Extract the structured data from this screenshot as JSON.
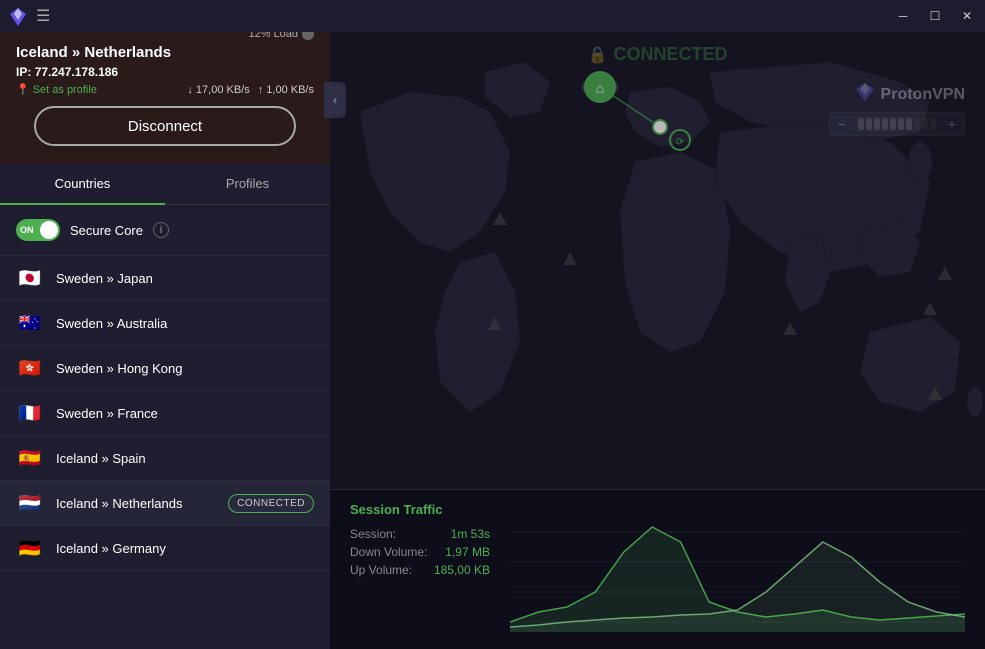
{
  "titlebar": {
    "minimize_label": "─",
    "maximize_label": "☐",
    "close_label": "✕",
    "menu_label": "☰"
  },
  "connection": {
    "title": "Iceland » Netherlands",
    "ip_label": "IP:",
    "ip_value": "77.247.178.186",
    "load_label": "12% Load",
    "set_profile_label": "Set as profile",
    "down_speed": "↓ 17,00 KB/s",
    "up_speed": "↑ 1,00 KB/s",
    "disconnect_label": "Disconnect"
  },
  "tabs": {
    "countries_label": "Countries",
    "profiles_label": "Profiles"
  },
  "secure_core": {
    "toggle_label": "ON",
    "label": "Secure Core",
    "info": "i"
  },
  "map": {
    "connected_label": "CONNECTED",
    "brand_label": "ProtonVPN"
  },
  "countries": [
    {
      "flag": "🇯🇵",
      "name": "Sweden » Japan"
    },
    {
      "flag": "🇦🇺",
      "name": "Sweden » Australia"
    },
    {
      "flag": "🇭🇰",
      "name": "Sweden » Hong Kong"
    },
    {
      "flag": "🇫🇷",
      "name": "Sweden » France"
    },
    {
      "flag": "🇪🇸",
      "name": "Iceland » Spain"
    },
    {
      "flag": "🇳🇱",
      "name": "Iceland » Netherlands",
      "connected": true,
      "badge": "CONNECTED"
    },
    {
      "flag": "🇩🇪",
      "name": "Iceland » Germany"
    }
  ],
  "stats": {
    "title": "Session Traffic",
    "session_label": "Session:",
    "session_value": "1m 53s",
    "down_label": "Down Volume:",
    "down_value": "1,97   MB",
    "up_label": "Up Volume:",
    "up_value": "185,00  KB"
  },
  "colors": {
    "green": "#4caf50",
    "bg_dark": "#141420",
    "bg_panel": "#1e1e30",
    "accent": "#6a5aff"
  }
}
